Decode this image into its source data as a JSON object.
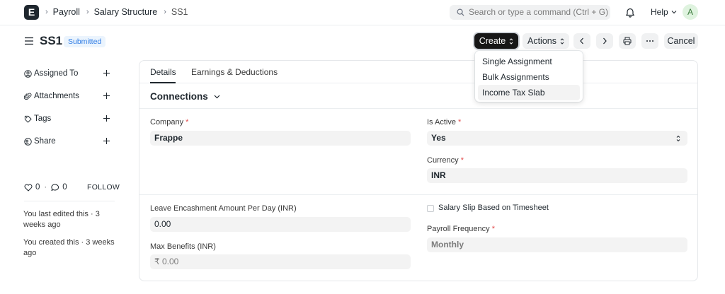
{
  "navbar": {
    "logo_letter": "E",
    "breadcrumbs": [
      "Payroll",
      "Salary Structure",
      "SS1"
    ],
    "search_placeholder": "Search or type a command (Ctrl + G)",
    "help_label": "Help",
    "avatar_initial": "A"
  },
  "page": {
    "title": "SS1",
    "status": "Submitted"
  },
  "toolbar": {
    "create_label": "Create",
    "actions_label": "Actions",
    "cancel_label": "Cancel"
  },
  "create_menu": {
    "items": [
      "Single Assignment",
      "Bulk Assignments",
      "Income Tax Slab"
    ]
  },
  "sidebar": {
    "items": [
      {
        "label": "Assigned To",
        "icon": "user-icon"
      },
      {
        "label": "Attachments",
        "icon": "paperclip-icon"
      },
      {
        "label": "Tags",
        "icon": "tag-icon"
      },
      {
        "label": "Share",
        "icon": "share-icon"
      }
    ],
    "likes_count": "0",
    "dot": "·",
    "comments_count": "0",
    "follow_label": "FOLLOW",
    "activity": [
      "You last edited this · 3 weeks ago",
      "You created this · 3 weeks ago"
    ]
  },
  "tabs": [
    "Details",
    "Earnings & Deductions"
  ],
  "section": {
    "title": "Connections"
  },
  "form": {
    "company_label": "Company",
    "company_value": "Frappe",
    "is_active_label": "Is Active",
    "is_active_value": "Yes",
    "currency_label": "Currency",
    "currency_value": "INR",
    "leave_label": "Leave Encashment Amount Per Day (INR)",
    "leave_value": "0.00",
    "salary_slip_label": "Salary Slip Based on Timesheet",
    "payroll_freq_label": "Payroll Frequency",
    "payroll_freq_value": "Monthly",
    "max_benefits_label": "Max Benefits (INR)",
    "max_benefits_value": "₹ 0.00",
    "required_mark": "*"
  },
  "colors": {
    "primary": "#171717",
    "badge_bg": "#ebf4fd",
    "badge_text": "#2d7be5",
    "required": "#e24c4c"
  }
}
